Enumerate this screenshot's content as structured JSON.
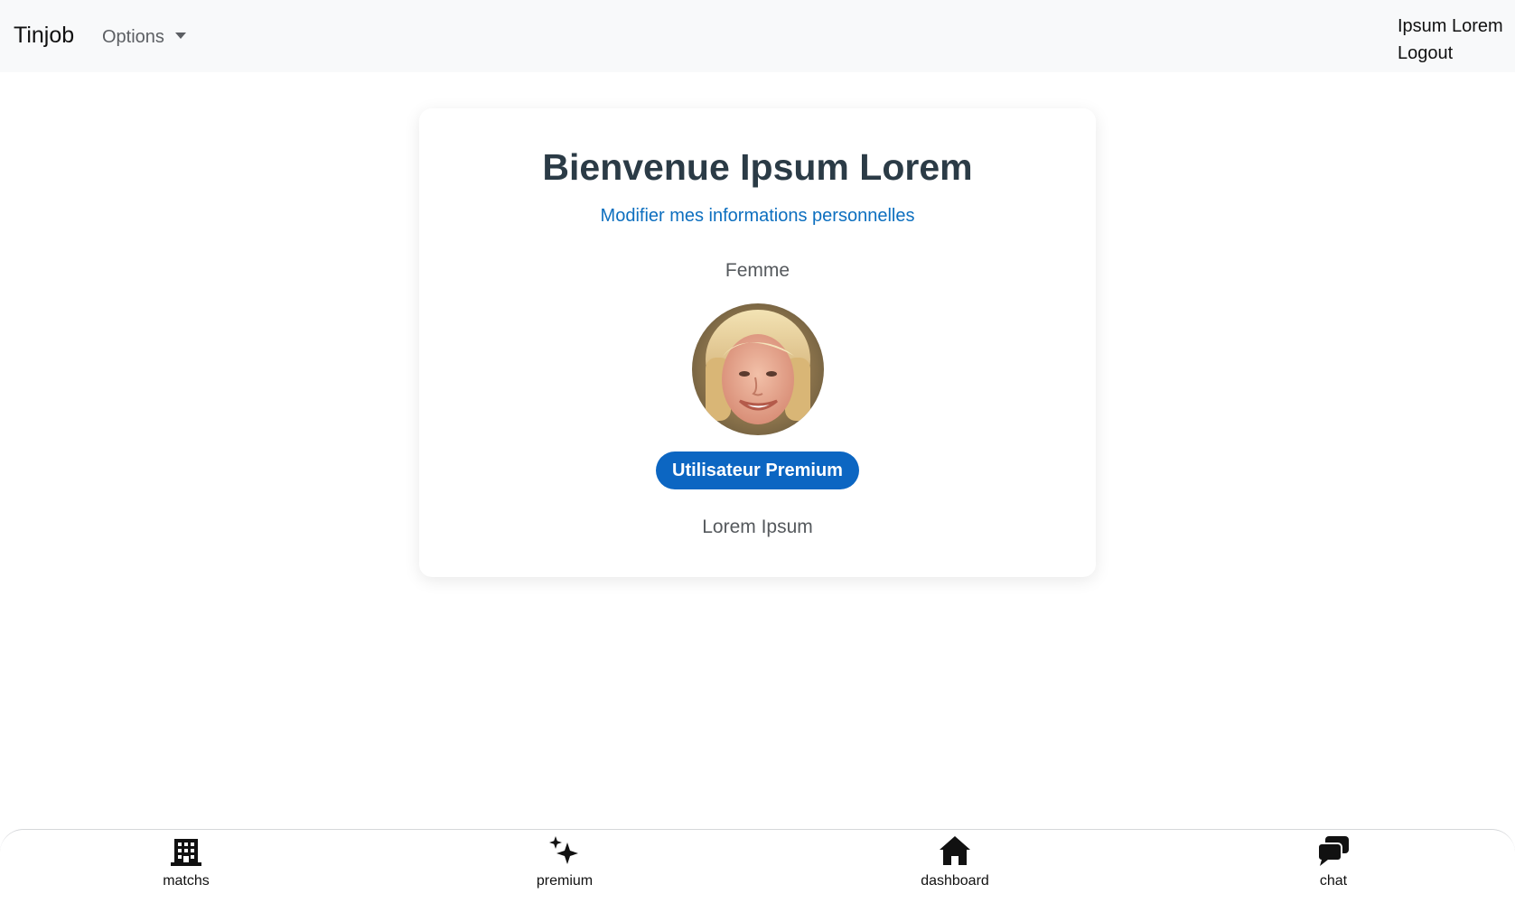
{
  "navbar": {
    "brand": "Tinjob",
    "options_label": "Options",
    "user_name": "Ipsum Lorem",
    "logout_label": "Logout"
  },
  "profile": {
    "welcome_title": "Bienvenue Ipsum Lorem",
    "edit_link": "Modifier mes informations personnelles",
    "gender": "Femme",
    "premium_badge": "Utilisateur Premium",
    "subtitle": "Lorem Ipsum"
  },
  "bottom_nav": {
    "items": [
      {
        "label": "matchs",
        "icon": "building-icon"
      },
      {
        "label": "premium",
        "icon": "sparkle-icon"
      },
      {
        "label": "dashboard",
        "icon": "house-icon"
      },
      {
        "label": "chat",
        "icon": "chat-icon"
      }
    ]
  },
  "colors": {
    "navbar_bg": "#f8f9fa",
    "link": "#0d6fbf",
    "premium_badge": "#0c66c2",
    "title": "#2b3b46"
  }
}
